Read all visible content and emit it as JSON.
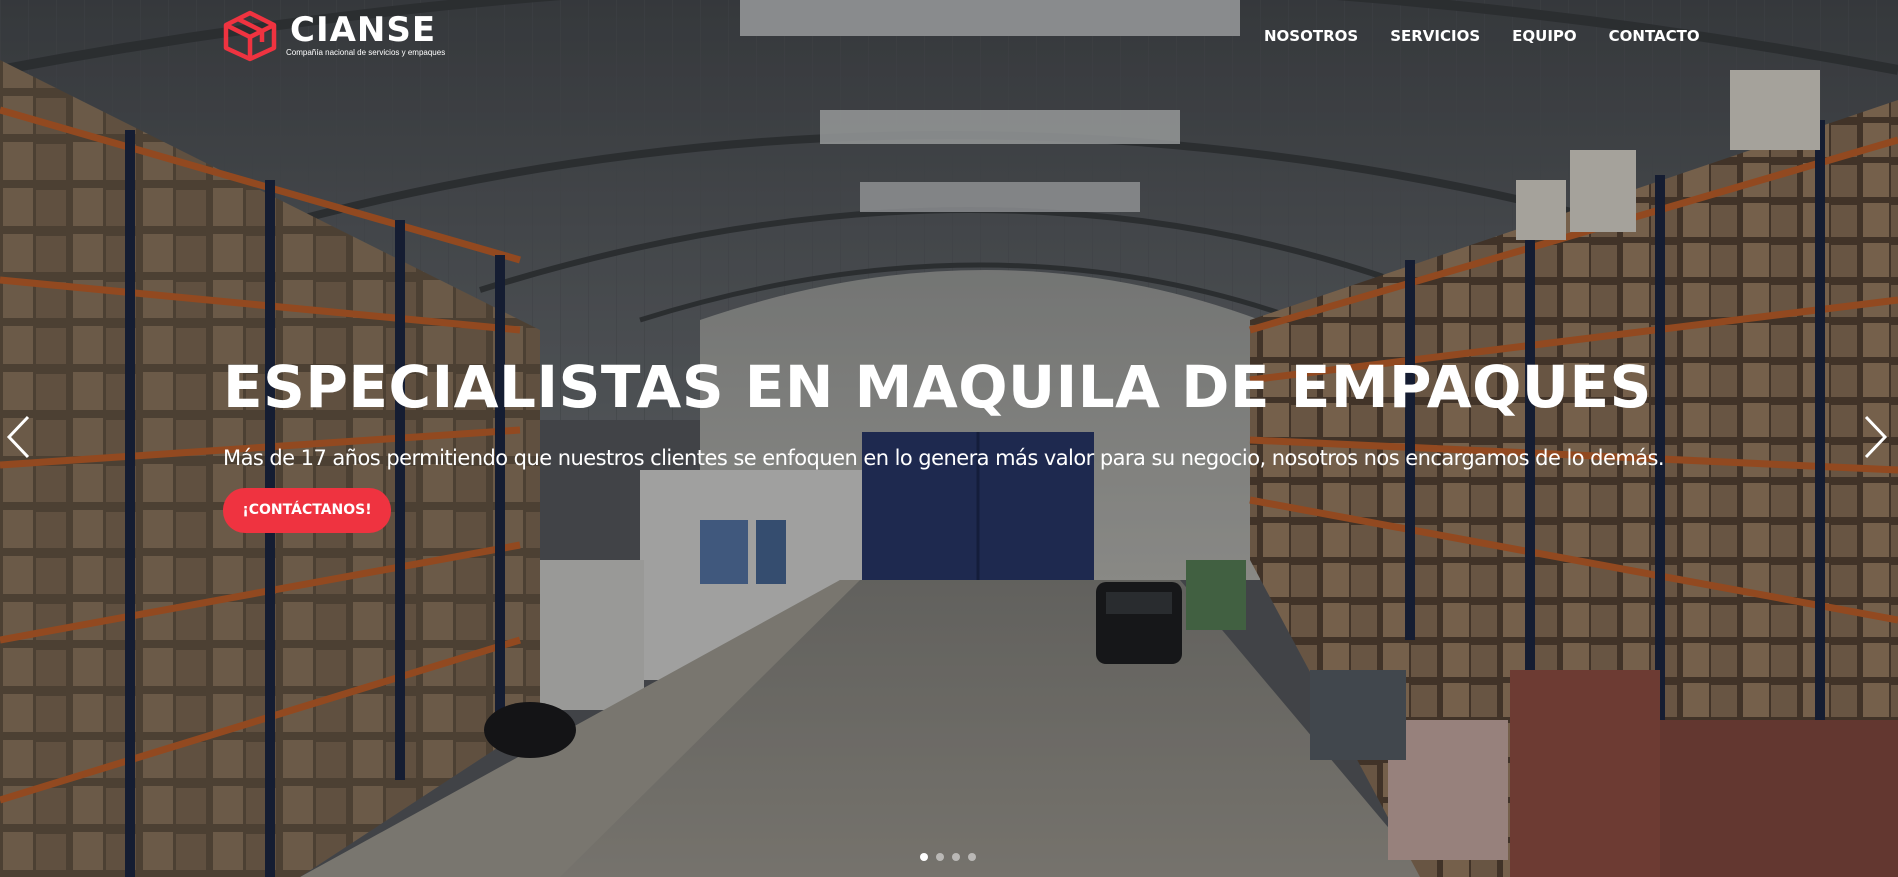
{
  "brand": {
    "name": "CIANSE",
    "tagline": "Compañía nacional de servicios y empaques",
    "logo_icon": "cube-logo-icon",
    "accent_color": "#ef3340"
  },
  "nav": {
    "items": [
      {
        "label": "NOSOTROS"
      },
      {
        "label": "SERVICIOS"
      },
      {
        "label": "EQUIPO"
      },
      {
        "label": "CONTACTO"
      }
    ]
  },
  "hero": {
    "background": "warehouse-photo",
    "title": "ESPECIALISTAS EN MAQUILA DE EMPAQUES",
    "subtitle": "Más de 17 años permitiendo que nuestros clientes se enfoquen en lo genera más valor para su negocio, nosotros nos encargamos de lo demás.",
    "cta_label": "¡CONTÁCTANOS!"
  },
  "carousel": {
    "prev_icon": "chevron-left-icon",
    "next_icon": "chevron-right-icon",
    "slide_count": 4,
    "active_slide": 1
  }
}
